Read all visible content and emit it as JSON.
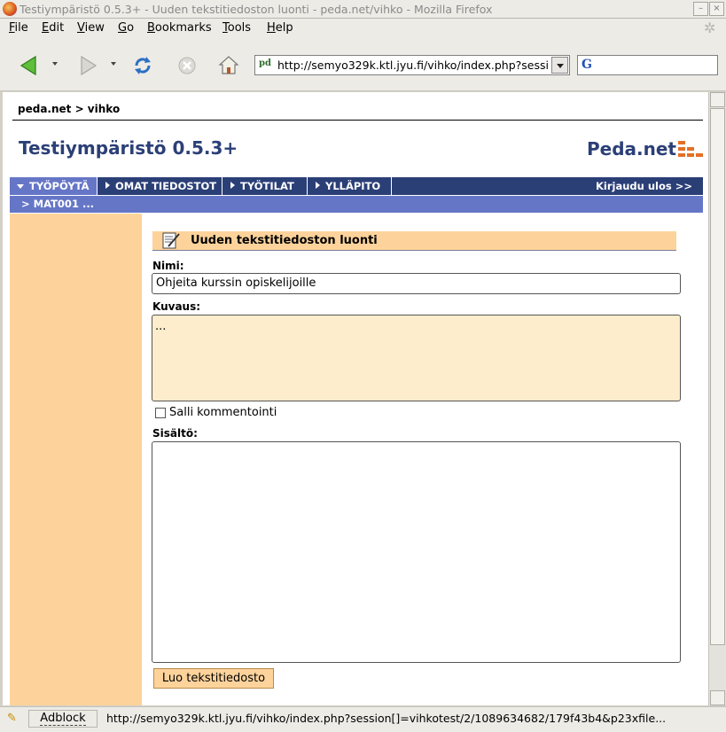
{
  "window": {
    "title": "Testiympäristö 0.5.3+ - Uuden tekstitiedoston luonti - peda.net/vihko - Mozilla Firefox",
    "minimize_glyph": "–",
    "close_glyph": "×"
  },
  "menu": [
    {
      "accel": "F",
      "rest": "ile"
    },
    {
      "accel": "E",
      "rest": "dit"
    },
    {
      "accel": "V",
      "rest": "iew"
    },
    {
      "accel": "G",
      "rest": "o"
    },
    {
      "accel": "B",
      "rest": "ookmarks"
    },
    {
      "accel": "T",
      "rest": "ools"
    },
    {
      "accel": "H",
      "rest": "elp"
    }
  ],
  "toolbar": {
    "url": "http://semyo329k.ktl.jyu.fi/vihko/index.php?session[]=vihkotest/2/1089634682/179f43b4",
    "search_value": "",
    "search_engine_glyph": "G"
  },
  "page": {
    "breadcrumb": "peda.net > vihko",
    "site_title": "Testiympäristö 0.5.3+",
    "logo_text": "Peda.net",
    "nav": {
      "tabs": [
        "TYÖPÖYTÄ",
        "OMAT TIEDOSTOT",
        "TYÖTILAT",
        "YLLÄPITO"
      ],
      "active_tab": "TYÖPÖYTÄ",
      "logout": "Kirjaudu ulos >>"
    },
    "subnav": "> MAT001 ...",
    "form": {
      "title": "Uuden tekstitiedoston luonti",
      "name_label": "Nimi:",
      "name_value": "Ohjeita kurssin opiskelijoille",
      "description_label": "Kuvaus:",
      "description_value": "...",
      "allow_comments_label": "Salli kommentointi",
      "allow_comments_checked": false,
      "content_label": "Sisältö:",
      "content_value": "",
      "submit_label": "Luo tekstitiedosto"
    }
  },
  "statusbar": {
    "adblock": "Adblock",
    "status_text": "http://semyo329k.ktl.jyu.fi/vihko/index.php?session[]=vihkotest/2/1089634682/179f43b4&p23xfile..."
  },
  "colors": {
    "nav_dark": "#2b3f77",
    "nav_light": "#6676c7",
    "orange_panel": "#fdd39b",
    "logo_orange": "#e46f27"
  }
}
